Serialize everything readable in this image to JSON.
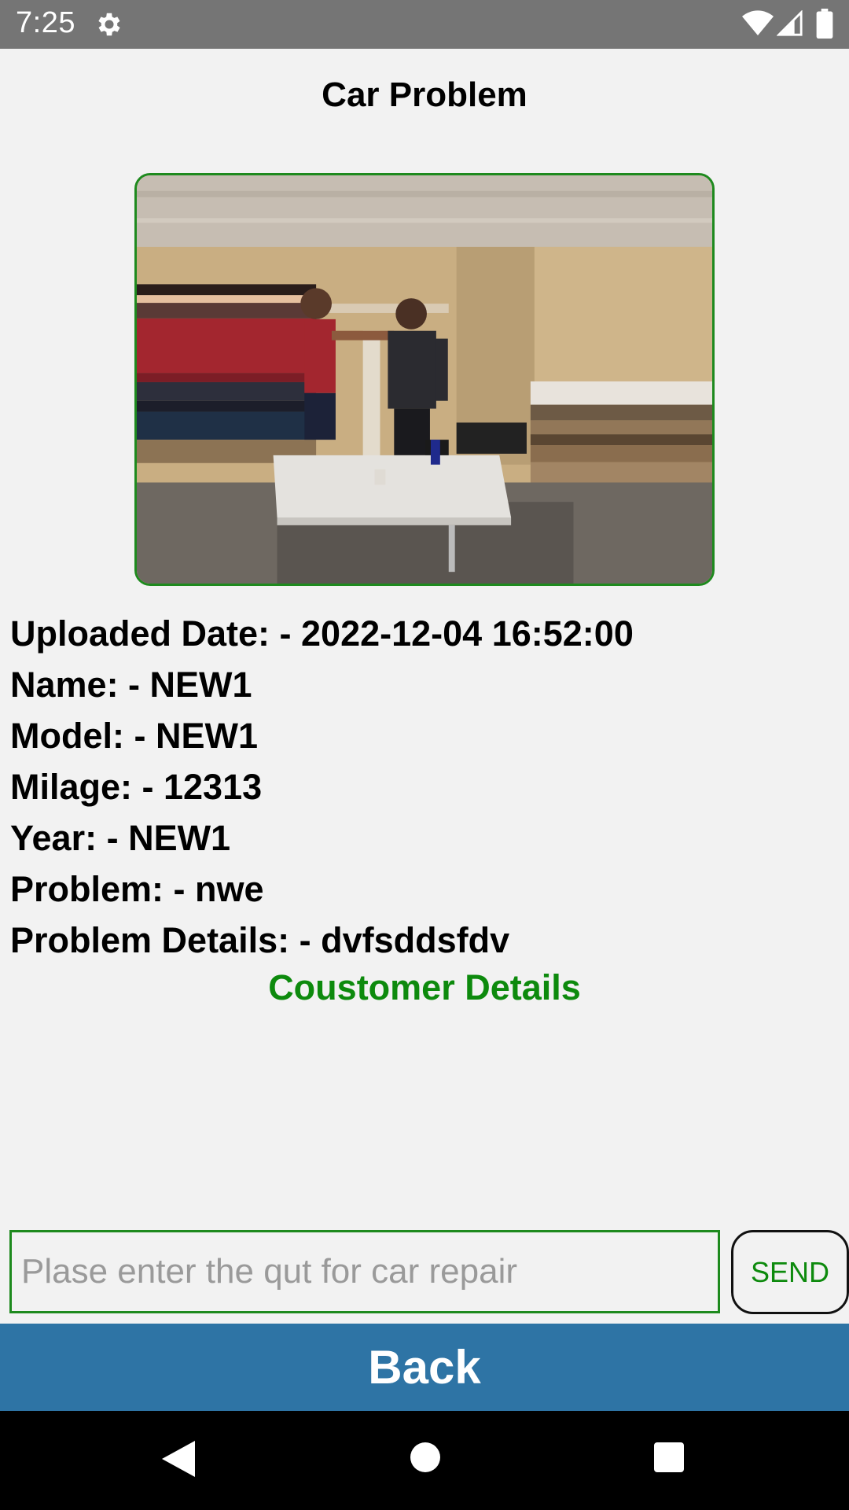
{
  "status_bar": {
    "time": "7:25",
    "icons": [
      "gear-icon",
      "wifi-icon",
      "signal-icon",
      "battery-icon"
    ]
  },
  "page": {
    "title": "Car Problem"
  },
  "details": [
    "Uploaded Date: - 2022-12-04 16:52:00",
    "Name: - NEW1",
    "Model: - NEW1",
    "Milage: - 12313",
    "Year: - NEW1",
    "Problem: - nwe",
    "Problem Details: - dvfsddsfdv"
  ],
  "customer_link": "Coustomer Details",
  "quote": {
    "placeholder": "Plase enter the qut for car repair",
    "value": "",
    "send_label": "SEND"
  },
  "back_label": "Back",
  "nav": {
    "icons": [
      "back-triangle-icon",
      "home-circle-icon",
      "recents-square-icon"
    ]
  },
  "colors": {
    "status_bar": "#757575",
    "accent_green": "#0d8a0d",
    "back_bar": "#2e74a5",
    "background": "#f2f2f2"
  }
}
